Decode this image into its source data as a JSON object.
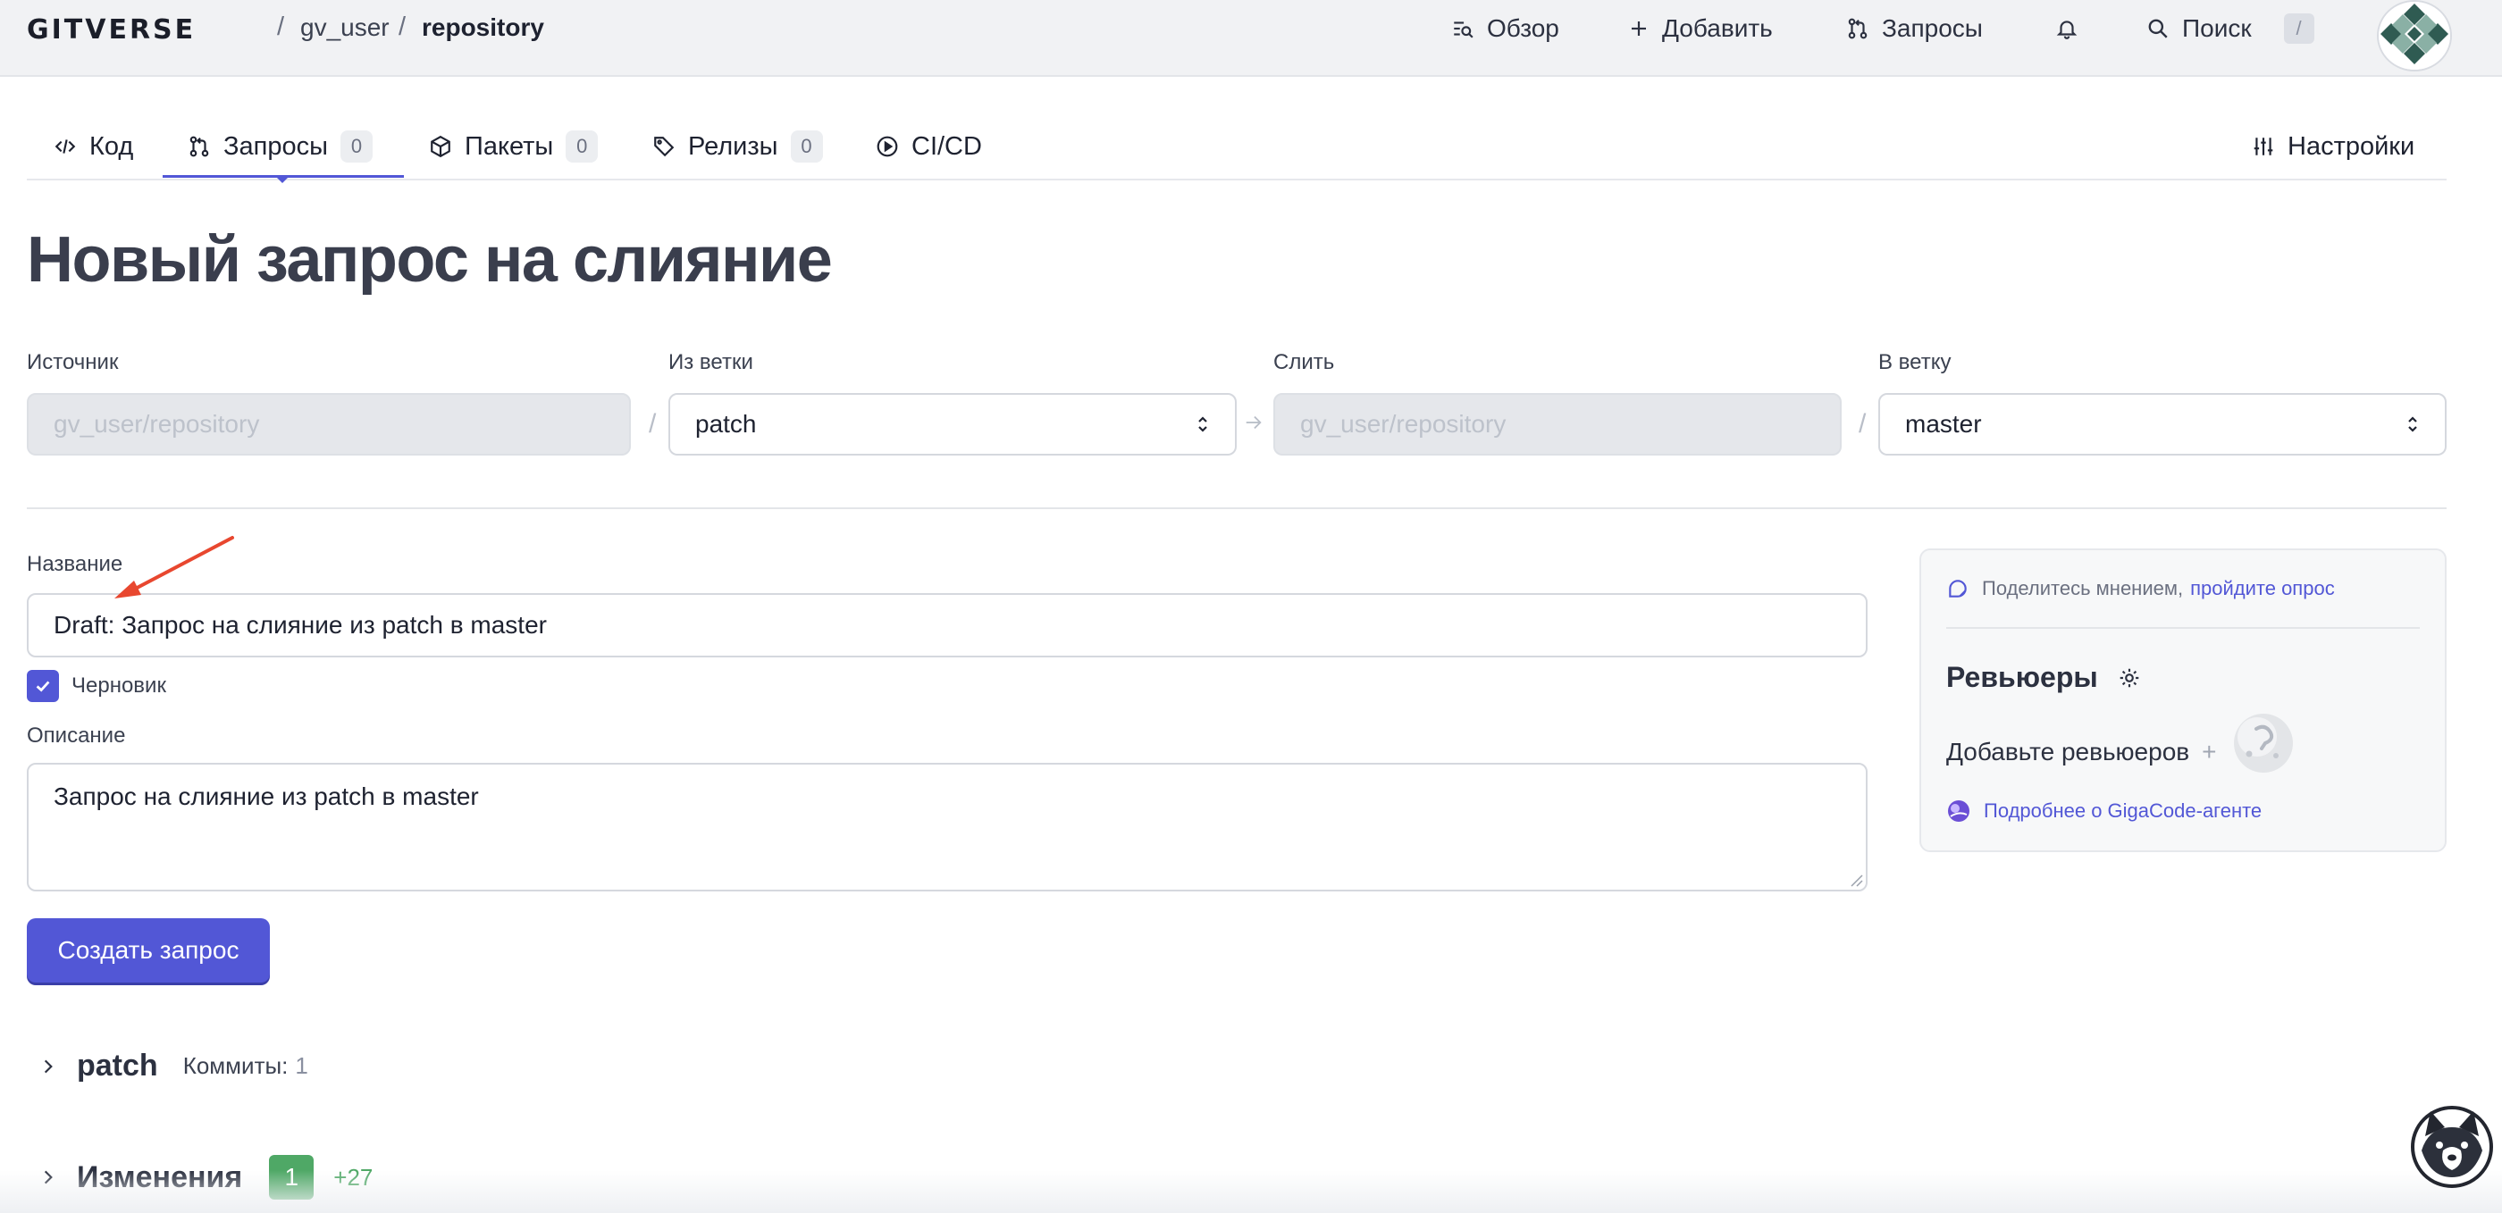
{
  "header": {
    "logo": "GITVERSE",
    "breadcrumb": {
      "sep": "/",
      "user": "gv_user",
      "repo": "repository"
    },
    "nav": {
      "overview": "Обзор",
      "add": "Добавить",
      "requests": "Запросы",
      "search": "Поиск",
      "search_key": "/"
    }
  },
  "tabs": [
    {
      "label": "Код"
    },
    {
      "label": "Запросы",
      "count": "0"
    },
    {
      "label": "Пакеты",
      "count": "0"
    },
    {
      "label": "Релизы",
      "count": "0"
    },
    {
      "label": "CI/CD"
    }
  ],
  "settings_label": "Настройки",
  "page_title": "Новый запрос на слияние",
  "branches": {
    "source_label": "Источник",
    "source_value": "gv_user/repository",
    "from_label": "Из ветки",
    "from_value": "patch",
    "merge_label": "Слить",
    "merge_value": "gv_user/repository",
    "to_label": "В ветку",
    "to_value": "master",
    "sep": "/"
  },
  "form": {
    "title_label": "Название",
    "title_value": "Draft: Запрос на слияние из patch в master",
    "draft_label": "Черновик",
    "draft_checked": true,
    "description_label": "Описание",
    "description_value": "Запрос на слияние из patch в master",
    "submit_label": "Создать запрос"
  },
  "sidebar": {
    "survey_text": "Поделитесь мнением,",
    "survey_link": "пройдите опрос",
    "reviewers_title": "Ревьюеры",
    "add_reviewers": "Добавьте ревьюеров",
    "add_plus": "+",
    "gigacode_link": "Подробнее о GigaCode-агенте"
  },
  "commits_section": {
    "branch": "patch",
    "commits_label": "Коммиты:",
    "commits_count": "1"
  },
  "changes_section": {
    "title": "Изменения",
    "files": "1",
    "additions": "+27"
  },
  "colors": {
    "accent": "#5257d6",
    "green": "#4fa866",
    "annotation_arrow": "#e8472f"
  }
}
